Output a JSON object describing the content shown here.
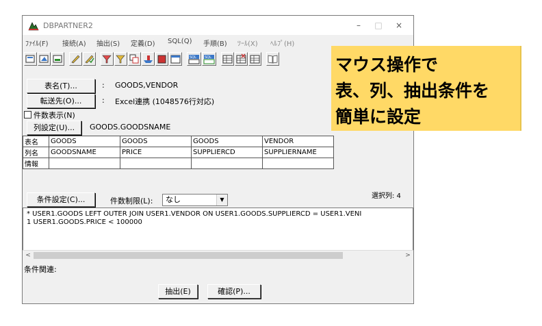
{
  "window": {
    "title": "DBPARTNER2",
    "minimize": "–",
    "maximize": "□",
    "close": "×"
  },
  "menu": {
    "items": [
      {
        "label": "ﾌｧｲﾙ(F)"
      },
      {
        "label": "接続(A)"
      },
      {
        "label": "抽出(S)"
      },
      {
        "label": "定義(D)"
      },
      {
        "label": "SQL(Q)"
      },
      {
        "label": "手順(B)"
      },
      {
        "label": "ﾂｰﾙ(X)"
      },
      {
        "label": "ﾍﾙﾌﾟ(H)"
      }
    ]
  },
  "toolbar": {
    "icons": [
      "open-icon",
      "save-icon",
      "export-icon",
      "edit-icon",
      "check-icon",
      "filter-icon",
      "filter2-icon",
      "copy-icon",
      "ship-icon",
      "stop-icon",
      "window-icon",
      "sql-run-icon",
      "sql-add-icon",
      "table-icon",
      "table-delete-icon",
      "table-edit-icon",
      "book-icon"
    ]
  },
  "form": {
    "table_button": "表名(T)...",
    "table_value": "GOODS,VENDOR",
    "dest_button": "転送先(O)...",
    "dest_value": "Excel連携 (1048576行対応)",
    "count_checkbox": "件数表示(N)",
    "col_button": "列設定(U)...",
    "col_value": "GOODS.GOODSNAME",
    "colon": ":"
  },
  "grid": {
    "row_headers": [
      "表名",
      "列名",
      "情報"
    ],
    "tables": [
      "GOODS",
      "GOODS",
      "GOODS",
      "VENDOR"
    ],
    "columns": [
      "GOODSNAME",
      "PRICE",
      "SUPPLIERCD",
      "SUPPLIERNAME"
    ],
    "info": [
      "",
      "",
      "",
      ""
    ]
  },
  "conditions": {
    "cond_button": "条件設定(C)...",
    "limit_label": "件数制限(L):",
    "limit_value": "なし",
    "selected_cols": "選択列: 4",
    "lines": [
      "*  USER1.GOODS LEFT OUTER JOIN USER1.VENDOR ON USER1.GOODS.SUPPLIERCD  =  USER1.VENI",
      "1  USER1.GOODS.PRICE  <  100000"
    ],
    "relation_label": "条件関連:"
  },
  "footer": {
    "extract_button": "抽出(E)",
    "confirm_button": "確認(P)..."
  },
  "callout": {
    "lines": [
      "マウス操作で",
      "表、列、抽出条件を",
      "簡単に設定"
    ],
    "color": "#ffd966"
  }
}
